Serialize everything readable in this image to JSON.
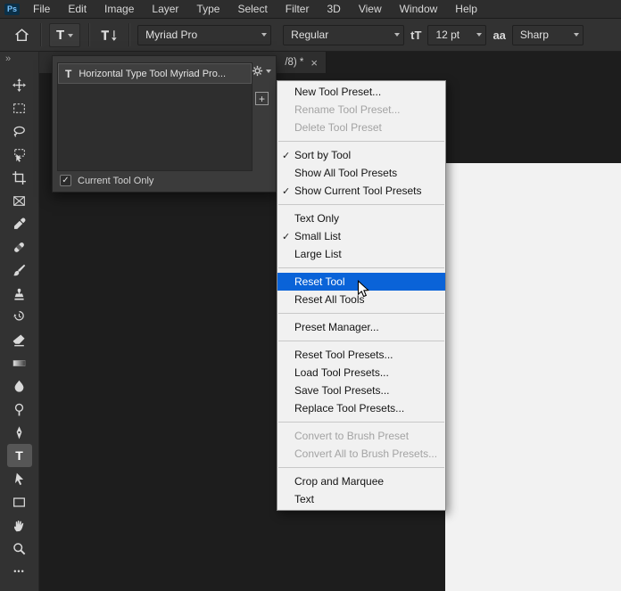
{
  "app": {
    "icon_label": "Ps"
  },
  "menubar": {
    "items": [
      "File",
      "Edit",
      "Image",
      "Layer",
      "Type",
      "Select",
      "Filter",
      "3D",
      "View",
      "Window",
      "Help"
    ]
  },
  "options_bar": {
    "tool_icon_glyph": "T",
    "font_family": "Myriad Pro",
    "font_style": "Regular",
    "size_icon_glyph": "tT",
    "font_size": "12 pt",
    "anti_alias_icon_glyph": "aa",
    "anti_alias": "Sharp"
  },
  "tab": {
    "title": "/8) *",
    "close_glyph": "×"
  },
  "toolbar": {
    "expand_icon": "»",
    "tools": [
      {
        "name": "move"
      },
      {
        "name": "rectangular-marquee"
      },
      {
        "name": "lasso"
      },
      {
        "name": "object-selection"
      },
      {
        "name": "crop"
      },
      {
        "name": "frame"
      },
      {
        "name": "eyedropper"
      },
      {
        "name": "spot-healing-brush"
      },
      {
        "name": "brush"
      },
      {
        "name": "clone-stamp"
      },
      {
        "name": "history-brush"
      },
      {
        "name": "eraser"
      },
      {
        "name": "gradient"
      },
      {
        "name": "blur"
      },
      {
        "name": "dodge"
      },
      {
        "name": "pen"
      },
      {
        "name": "horizontal-type",
        "selected": true
      },
      {
        "name": "path-selection"
      },
      {
        "name": "rectangle"
      },
      {
        "name": "hand"
      },
      {
        "name": "zoom"
      },
      {
        "name": "edit-toolbar"
      }
    ]
  },
  "preset_picker": {
    "icon_glyph": "T",
    "preset_name": "Horizontal Type Tool Myriad Pro...",
    "new_preset_glyph": "+",
    "check_glyph": "✓",
    "current_tool_only_label": "Current Tool Only"
  },
  "context_menu": {
    "highlight_color": "#0a63d8",
    "check_glyph": "✓",
    "groups": [
      {
        "items": [
          {
            "label": "New Tool Preset..."
          },
          {
            "label": "Rename Tool Preset...",
            "disabled": true
          },
          {
            "label": "Delete Tool Preset",
            "disabled": true
          }
        ]
      },
      {
        "items": [
          {
            "label": "Sort by Tool",
            "checked": true
          },
          {
            "label": "Show All Tool Presets"
          },
          {
            "label": "Show Current Tool Presets",
            "checked": true
          }
        ]
      },
      {
        "items": [
          {
            "label": "Text Only"
          },
          {
            "label": "Small List",
            "checked": true
          },
          {
            "label": "Large List"
          }
        ]
      },
      {
        "items": [
          {
            "label": "Reset Tool",
            "highlighted": true
          },
          {
            "label": "Reset All Tools"
          }
        ]
      },
      {
        "items": [
          {
            "label": "Preset Manager..."
          }
        ]
      },
      {
        "items": [
          {
            "label": "Reset Tool Presets..."
          },
          {
            "label": "Load Tool Presets..."
          },
          {
            "label": "Save Tool Presets..."
          },
          {
            "label": "Replace Tool Presets..."
          }
        ]
      },
      {
        "items": [
          {
            "label": "Convert to Brush Preset",
            "disabled": true
          },
          {
            "label": "Convert All to Brush Presets...",
            "disabled": true
          }
        ]
      },
      {
        "items": [
          {
            "label": "Crop and Marquee"
          },
          {
            "label": "Text"
          }
        ]
      }
    ]
  }
}
